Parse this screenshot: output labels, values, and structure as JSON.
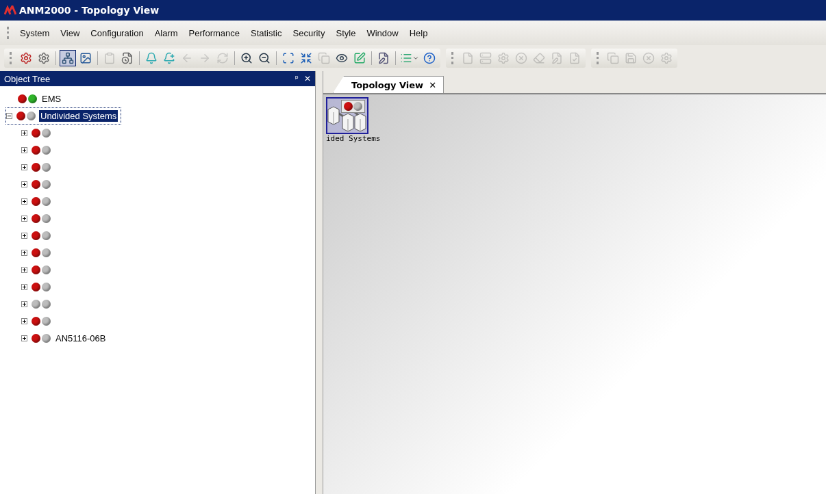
{
  "window": {
    "title": "ANM2000 - Topology View"
  },
  "menu": [
    "System",
    "View",
    "Configuration",
    "Alarm",
    "Performance",
    "Statistic",
    "Security",
    "Style",
    "Window",
    "Help"
  ],
  "toolbar": [
    [
      [
        {
          "disabled": false,
          "selected": false
        },
        {
          "disabled": false,
          "selected": false
        }
      ],
      [
        {
          "disabled": false,
          "selected": true
        },
        {
          "disabled": false,
          "selected": false
        }
      ],
      [
        {
          "disabled": true,
          "selected": false
        },
        {
          "disabled": false,
          "selected": false
        }
      ],
      [
        {
          "disabled": false,
          "selected": false
        },
        {
          "disabled": false,
          "selected": false
        },
        {
          "disabled": true,
          "selected": false
        },
        {
          "disabled": true,
          "selected": false
        },
        {
          "disabled": true,
          "selected": false
        }
      ],
      [
        {
          "disabled": false,
          "selected": false
        },
        {
          "disabled": false,
          "selected": false
        }
      ],
      [
        {
          "disabled": false,
          "selected": false
        },
        {
          "disabled": false,
          "selected": false
        },
        {
          "disabled": true,
          "selected": false
        },
        {
          "disabled": false,
          "selected": false
        },
        {
          "disabled": false,
          "selected": false
        }
      ],
      [
        {
          "disabled": false,
          "selected": false
        }
      ],
      [
        {
          "disabled": false,
          "selected": false
        },
        {
          "disabled": false,
          "selected": false
        }
      ]
    ],
    [
      [
        {
          "disabled": true,
          "selected": false
        },
        {
          "disabled": true,
          "selected": false
        },
        {
          "disabled": true,
          "selected": false
        },
        {
          "disabled": true,
          "selected": false
        },
        {
          "disabled": true,
          "selected": false
        },
        {
          "disabled": true,
          "selected": false
        },
        {
          "disabled": true,
          "selected": false
        }
      ]
    ],
    [
      [
        {
          "disabled": true,
          "selected": false
        },
        {
          "disabled": true,
          "selected": false
        },
        {
          "disabled": true,
          "selected": false
        },
        {
          "disabled": true,
          "selected": false
        }
      ]
    ]
  ],
  "object_tree": {
    "title": "Object Tree",
    "pin": "ᵖ",
    "close": "✕",
    "nodes": [
      {
        "label": "EMS",
        "selected": false,
        "lights": [
          {
            "color": "#cc1010"
          },
          {
            "color": "#2fb52a"
          }
        ]
      },
      {
        "label": "Undivided Systems",
        "selected": true,
        "expanded": true,
        "lights": [
          {
            "color": "#cc1010"
          },
          {
            "color": "#bdbdbd"
          }
        ],
        "children": [
          {
            "selected": false,
            "expanded": false,
            "lights": [
              {
                "color": "#cc1010"
              },
              {
                "color": "#bdbdbd"
              }
            ]
          },
          {
            "selected": false,
            "expanded": false,
            "lights": [
              {
                "color": "#cc1010"
              },
              {
                "color": "#bdbdbd"
              }
            ]
          },
          {
            "selected": false,
            "expanded": false,
            "lights": [
              {
                "color": "#cc1010"
              },
              {
                "color": "#bdbdbd"
              }
            ]
          },
          {
            "selected": false,
            "expanded": false,
            "lights": [
              {
                "color": "#cc1010"
              },
              {
                "color": "#bdbdbd"
              }
            ]
          },
          {
            "selected": false,
            "expanded": false,
            "lights": [
              {
                "color": "#cc1010"
              },
              {
                "color": "#bdbdbd"
              }
            ]
          },
          {
            "selected": false,
            "expanded": false,
            "lights": [
              {
                "color": "#cc1010"
              },
              {
                "color": "#bdbdbd"
              }
            ]
          },
          {
            "selected": false,
            "expanded": false,
            "lights": [
              {
                "color": "#cc1010"
              },
              {
                "color": "#bdbdbd"
              }
            ]
          },
          {
            "selected": false,
            "expanded": false,
            "lights": [
              {
                "color": "#cc1010"
              },
              {
                "color": "#bdbdbd"
              }
            ]
          },
          {
            "selected": false,
            "expanded": false,
            "lights": [
              {
                "color": "#cc1010"
              },
              {
                "color": "#bdbdbd"
              }
            ]
          },
          {
            "selected": false,
            "expanded": false,
            "lights": [
              {
                "color": "#cc1010"
              },
              {
                "color": "#bdbdbd"
              }
            ]
          },
          {
            "selected": false,
            "expanded": false,
            "lights": [
              {
                "color": "#bdbdbd"
              },
              {
                "color": "#bdbdbd"
              }
            ]
          },
          {
            "selected": false,
            "expanded": false,
            "lights": [
              {
                "color": "#cc1010"
              },
              {
                "color": "#bdbdbd"
              }
            ]
          },
          {
            "label": "AN5116-06B",
            "selected": false,
            "expanded": false,
            "lights": [
              {
                "color": "#cc1010"
              },
              {
                "color": "#bdbdbd"
              }
            ]
          }
        ]
      }
    ]
  },
  "tabs": [
    {
      "label": "Topology View",
      "close": "✕",
      "selected": true
    }
  ],
  "topology": {
    "nodes": [
      {
        "label": "ided Systems",
        "selected": true,
        "lights": [
          {
            "color": "#cc1010"
          },
          {
            "color": "#bdbdbd"
          }
        ]
      }
    ]
  }
}
